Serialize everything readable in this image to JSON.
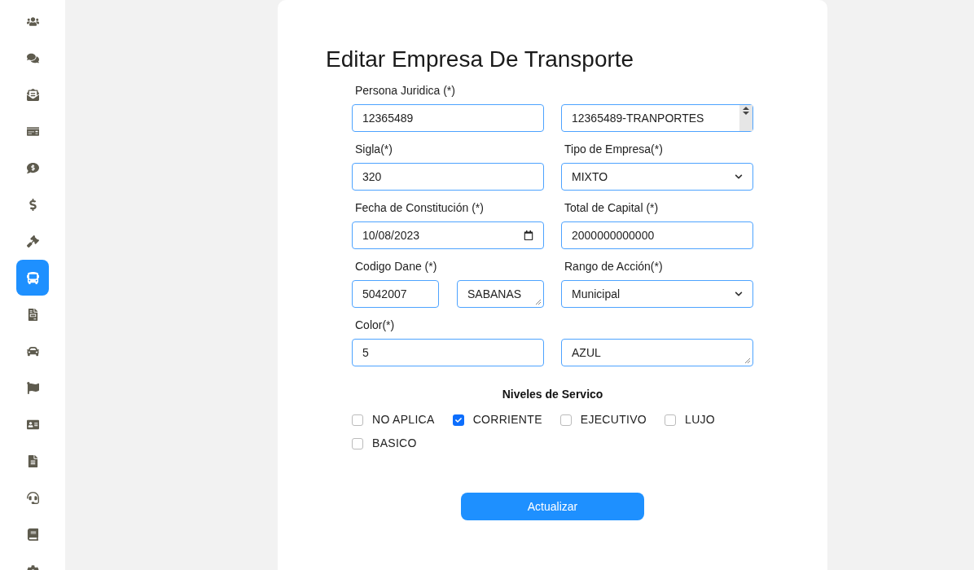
{
  "sidebar": {
    "items": [
      {
        "selected": false
      },
      {
        "selected": false
      },
      {
        "selected": false
      },
      {
        "selected": false
      },
      {
        "selected": false
      },
      {
        "selected": false
      },
      {
        "selected": false
      },
      {
        "selected": true
      },
      {
        "selected": false
      },
      {
        "selected": false
      },
      {
        "selected": false
      },
      {
        "selected": false
      },
      {
        "selected": false
      },
      {
        "selected": false
      },
      {
        "selected": false
      },
      {
        "selected": false
      }
    ]
  },
  "form": {
    "title": "Editar Empresa De Transporte",
    "rows": [
      {
        "left": {
          "label": "Persona Juridica (*)",
          "fields": [
            {
              "kind": "input",
              "value": "12365489"
            }
          ]
        },
        "right": {
          "field": {
            "kind": "spin",
            "value": "12365489-TRANPORTES"
          }
        }
      },
      {
        "left": {
          "label": "Sigla(*)",
          "fields": [
            {
              "kind": "input",
              "value": "320"
            }
          ]
        },
        "right": {
          "label": "Tipo de Empresa(*)",
          "field": {
            "kind": "select",
            "value": "MIXTO"
          }
        }
      },
      {
        "left": {
          "label": "Fecha de Constitución (*)",
          "fields": [
            {
              "kind": "date",
              "value": "10/08/2023"
            }
          ]
        },
        "right": {
          "label": "Total de Capital (*)",
          "field": {
            "kind": "input",
            "value": "2000000000000"
          }
        }
      },
      {
        "left": {
          "label": "Codigo Dane (*)",
          "fields": [
            {
              "kind": "input",
              "value": "5042007"
            },
            {
              "kind": "textarea",
              "value": "SABANAS"
            }
          ]
        },
        "right": {
          "label": "Rango de Acción(*)",
          "field": {
            "kind": "select",
            "value": "Municipal"
          }
        }
      },
      {
        "left": {
          "label": "Color(*)",
          "fields": [
            {
              "kind": "input",
              "value": "5"
            }
          ]
        },
        "right": {
          "field": {
            "kind": "textarea",
            "value": "AZUL"
          }
        }
      }
    ],
    "levels_title": "Niveles de Servico",
    "levels": [
      {
        "label": "NO APLICA",
        "checked": false
      },
      {
        "label": "CORRIENTE",
        "checked": true
      },
      {
        "label": "EJECUTIVO",
        "checked": false
      },
      {
        "label": "LUJO",
        "checked": false
      },
      {
        "label": "BASICO",
        "checked": false
      }
    ],
    "submit": "Actualizar"
  }
}
